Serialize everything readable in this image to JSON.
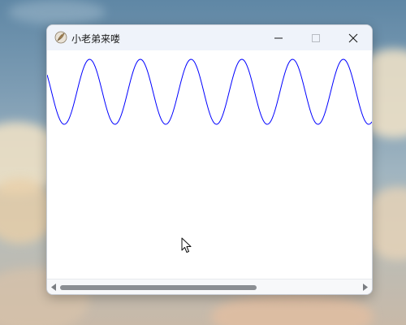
{
  "window": {
    "title": "小老弟来喽",
    "controls": {
      "minimize_icon": "minimize-icon",
      "maximize_icon": "maximize-icon",
      "close_icon": "close-icon"
    }
  },
  "canvas": {
    "content": "sine-wave",
    "wave": {
      "cycles_visible": 6.4,
      "color": "#0000ff"
    }
  },
  "scrollbar": {
    "orientation": "horizontal",
    "thumb_fraction": 0.65,
    "position_fraction": 0.0
  },
  "colors": {
    "titlebar": "#eff3fa",
    "canvas_bg": "#ffffff",
    "wave": "#0000ff",
    "scroll_thumb": "#8b8e93"
  }
}
